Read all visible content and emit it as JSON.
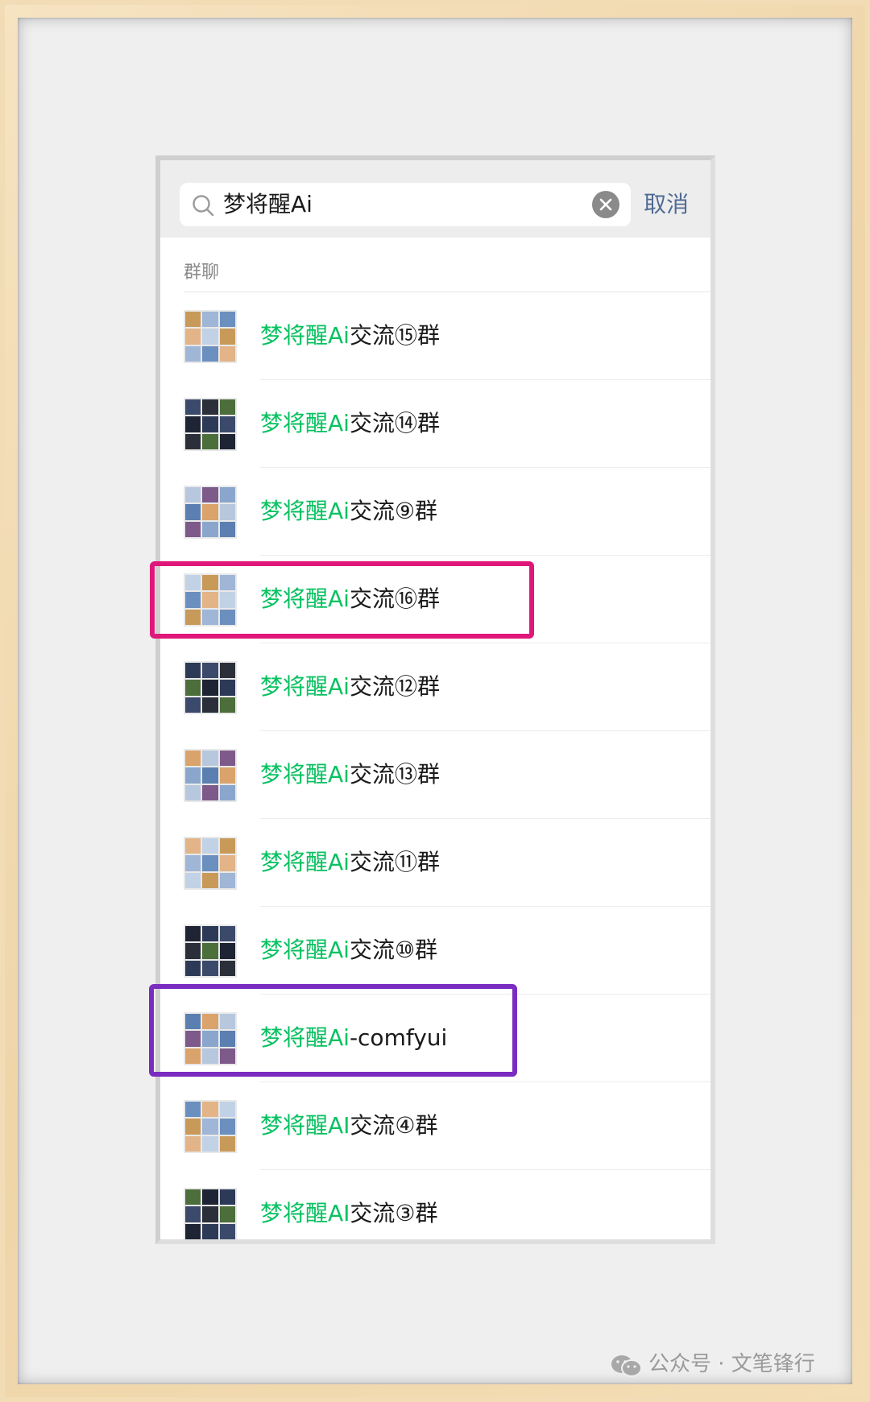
{
  "search": {
    "query": "梦将醒Ai",
    "cancel_label": "取消"
  },
  "section": {
    "label": "群聊"
  },
  "groups": [
    {
      "prefix": "梦将醒Ai",
      "suffix": "交流⑮群"
    },
    {
      "prefix": "梦将醒Ai",
      "suffix": "交流⑭群"
    },
    {
      "prefix": "梦将醒Ai",
      "suffix": "交流⑨群"
    },
    {
      "prefix": "梦将醒Ai",
      "suffix": "交流⑯群"
    },
    {
      "prefix": "梦将醒Ai",
      "suffix": "交流⑫群"
    },
    {
      "prefix": "梦将醒Ai",
      "suffix": "交流⑬群"
    },
    {
      "prefix": "梦将醒Ai",
      "suffix": "交流⑪群"
    },
    {
      "prefix": "梦将醒Ai",
      "suffix": "交流⑩群"
    },
    {
      "prefix": "梦将醒Ai",
      "suffix": "-comfyui"
    },
    {
      "prefix": "梦将醒AI",
      "suffix": "交流④群"
    },
    {
      "prefix": "梦将醒AI",
      "suffix": "交流③群"
    }
  ],
  "highlight_colors": {
    "match_text": "#07c160",
    "annotation_magenta": "#e0177a",
    "annotation_purple": "#7a2cc0"
  },
  "watermark": {
    "text": "公众号 · 文笔锋行",
    "icon": "wechat-icon"
  }
}
